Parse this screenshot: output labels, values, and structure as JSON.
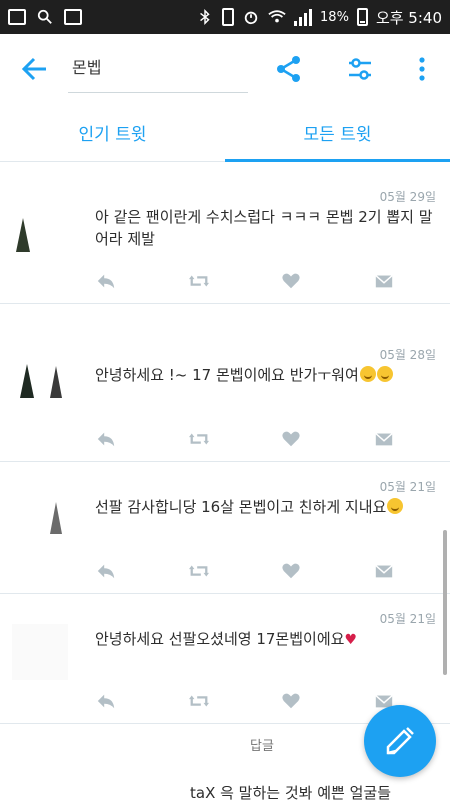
{
  "status_bar": {
    "battery_percent": "18%",
    "time": "오후 5:40"
  },
  "toolbar": {
    "title": "몬벱"
  },
  "tabs": [
    {
      "label": "인기 트윗",
      "active": false
    },
    {
      "label": "모든 트윗",
      "active": true
    }
  ],
  "tweets": [
    {
      "date": "05월 29일",
      "text": "아 같은 팬이란게 수치스럽다 ㅋㅋㅋ 몬벱 2기 뽑지 말어라 제발"
    },
    {
      "date": "05월 28일",
      "text": "안녕하세요 !~ 17 몬벱이에요 반가ㅜ워여"
    },
    {
      "date": "05월 21일",
      "text": "선팔 감사합니당 16살 몬벱이고 친하게 지내요"
    },
    {
      "date": "05월 21일",
      "text": "안녕하세요 선팔오셨네영 17몬벱이에요"
    },
    {
      "date": "",
      "text": "답글"
    },
    {
      "date": "",
      "text": "taX 윽 말하는 것봐 예쁜 얼굴들"
    }
  ],
  "colors": {
    "accent": "#1da1f2",
    "icon_gray": "#b3bfc6",
    "status_bar_bg": "#1f1f1f"
  }
}
